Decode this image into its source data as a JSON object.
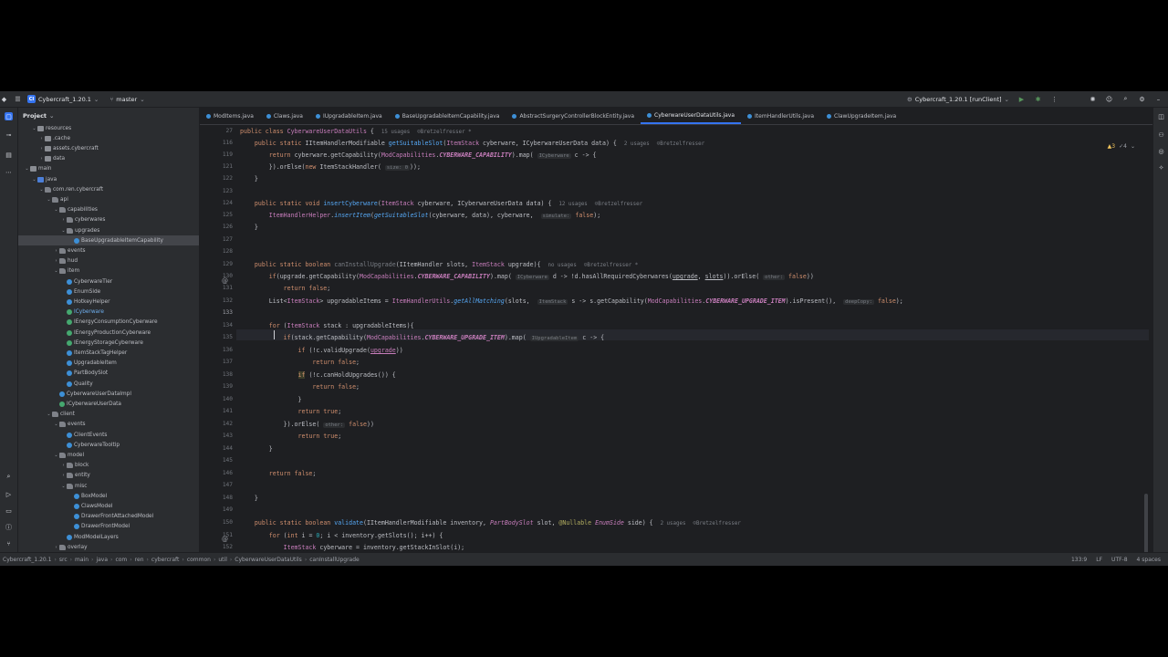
{
  "titlebar": {
    "project_badge": "CI",
    "project_name": "Cybercraft_1.20.1",
    "branch": "master",
    "run_config": "Cybercraft_1.20.1 [runClient]"
  },
  "project_panel": {
    "title": "Project",
    "rows": [
      {
        "label": "resources",
        "indent": 3,
        "icon": "folder",
        "twist": "v"
      },
      {
        "label": ".cache",
        "indent": 4,
        "icon": "folder",
        "twist": ">"
      },
      {
        "label": "assets.cybercraft",
        "indent": 4,
        "icon": "folder",
        "twist": ">"
      },
      {
        "label": "data",
        "indent": 4,
        "icon": "folder",
        "twist": ">"
      },
      {
        "label": "main",
        "indent": 2,
        "icon": "folder",
        "twist": "v"
      },
      {
        "label": "java",
        "indent": 3,
        "icon": "src",
        "twist": "v"
      },
      {
        "label": "com.ren.cybercraft",
        "indent": 4,
        "icon": "pkg",
        "twist": "v"
      },
      {
        "label": "api",
        "indent": 5,
        "icon": "pkg",
        "twist": "v"
      },
      {
        "label": "capabilities",
        "indent": 6,
        "icon": "pkg",
        "twist": "v"
      },
      {
        "label": "cyberwares",
        "indent": 7,
        "icon": "pkg",
        "twist": ">"
      },
      {
        "label": "upgrades",
        "indent": 7,
        "icon": "pkg",
        "twist": "v"
      },
      {
        "label": "BaseUpgradableItemCapability",
        "indent": 8,
        "icon": "cls",
        "twist": "",
        "selected": true
      },
      {
        "label": "events",
        "indent": 6,
        "icon": "pkg",
        "twist": ">"
      },
      {
        "label": "hud",
        "indent": 6,
        "icon": "pkg",
        "twist": ">"
      },
      {
        "label": "item",
        "indent": 6,
        "icon": "pkg",
        "twist": "v"
      },
      {
        "label": "CyberwareTier",
        "indent": 7,
        "icon": "cls",
        "twist": ""
      },
      {
        "label": "EnumSide",
        "indent": 7,
        "icon": "cls",
        "twist": ""
      },
      {
        "label": "HotkeyHelper",
        "indent": 7,
        "icon": "cls",
        "twist": ""
      },
      {
        "label": "ICyberware",
        "indent": 7,
        "icon": "itf",
        "twist": "",
        "blue": true
      },
      {
        "label": "IEnergyConsumptionCyberware",
        "indent": 7,
        "icon": "itf",
        "twist": ""
      },
      {
        "label": "IEnergyProductionCyberware",
        "indent": 7,
        "icon": "itf",
        "twist": ""
      },
      {
        "label": "IEnergyStorageCyberware",
        "indent": 7,
        "icon": "itf",
        "twist": ""
      },
      {
        "label": "ItemStackTagHelper",
        "indent": 7,
        "icon": "cls",
        "twist": ""
      },
      {
        "label": "UpgradableItem",
        "indent": 7,
        "icon": "cls",
        "twist": ""
      },
      {
        "label": "PartBodySlot",
        "indent": 7,
        "icon": "cls",
        "twist": ""
      },
      {
        "label": "Quality",
        "indent": 7,
        "icon": "cls",
        "twist": ""
      },
      {
        "label": "CyberwareUserDataImpl",
        "indent": 6,
        "icon": "cls",
        "twist": ""
      },
      {
        "label": "ICyberwareUserData",
        "indent": 6,
        "icon": "itf",
        "twist": ""
      },
      {
        "label": "client",
        "indent": 5,
        "icon": "pkg",
        "twist": "v"
      },
      {
        "label": "events",
        "indent": 6,
        "icon": "pkg",
        "twist": "v"
      },
      {
        "label": "ClientEvents",
        "indent": 7,
        "icon": "cls",
        "twist": ""
      },
      {
        "label": "CyberwareTooltip",
        "indent": 7,
        "icon": "cls",
        "twist": ""
      },
      {
        "label": "model",
        "indent": 6,
        "icon": "pkg",
        "twist": "v"
      },
      {
        "label": "block",
        "indent": 7,
        "icon": "pkg",
        "twist": ">"
      },
      {
        "label": "entity",
        "indent": 7,
        "icon": "pkg",
        "twist": ">"
      },
      {
        "label": "misc",
        "indent": 7,
        "icon": "pkg",
        "twist": "v"
      },
      {
        "label": "BoxModel",
        "indent": 8,
        "icon": "cls",
        "twist": ""
      },
      {
        "label": "ClawsModel",
        "indent": 8,
        "icon": "cls",
        "twist": ""
      },
      {
        "label": "DrawerFrontAttachedModel",
        "indent": 8,
        "icon": "cls",
        "twist": ""
      },
      {
        "label": "DrawerFrontModel",
        "indent": 8,
        "icon": "cls",
        "twist": ""
      },
      {
        "label": "ModModelLayers",
        "indent": 7,
        "icon": "cls",
        "twist": ""
      },
      {
        "label": "overlay",
        "indent": 6,
        "icon": "pkg",
        "twist": ">"
      }
    ]
  },
  "tabs": [
    {
      "label": "ModItems.java",
      "active": false
    },
    {
      "label": "Claws.java",
      "active": false
    },
    {
      "label": "IUpgradableItem.java",
      "active": false
    },
    {
      "label": "BaseUpgradableItemCapability.java",
      "active": false
    },
    {
      "label": "AbstractSurgeryControllerBlockEntity.java",
      "active": false
    },
    {
      "label": "CyberwareUserDataUtils.java",
      "active": true
    },
    {
      "label": "ItemHandlerUtils.java",
      "active": false
    },
    {
      "label": "ClawUpgradeItem.java",
      "active": false
    }
  ],
  "inspections": {
    "warnings": "▲3",
    "weak": "✓4"
  },
  "line_numbers": [
    "27",
    "116",
    "119",
    "121",
    "122",
    "123",
    "124",
    "125",
    "126",
    "127",
    "128",
    "129",
    "130",
    "131",
    "132",
    "133",
    "134",
    "135",
    "136",
    "137",
    "138",
    "139",
    "140",
    "141",
    "142",
    "143",
    "144",
    "145",
    "146",
    "147",
    "148",
    "149",
    "150",
    "151",
    "152"
  ],
  "current_line": "133",
  "code": {
    "header": {
      "usages": "15 usages",
      "author": "Bretzelfresser *"
    },
    "l116": {
      "usages": "2 usages",
      "author": "Bretzelfresser"
    },
    "l121_hint": "size: 0",
    "l124": {
      "usages": "12 usages",
      "author": "Bretzelfresser"
    },
    "l125_hint": "simulate:",
    "l129": {
      "usages": "no usages",
      "author": "Bretzelfresser *"
    },
    "hint_icyberware": "ICyberware",
    "hint_other": "other:",
    "hint_itemstack": "ItemStack",
    "hint_deepcopy": "deepCopy:",
    "hint_iupgradable": "IUpgradableItem",
    "l150": {
      "usages": "2 usages",
      "author": "Bretzelfresser"
    }
  },
  "status": {
    "crumbs": [
      "Cybercraft_1.20.1",
      "src",
      "main",
      "java",
      "com",
      "ren",
      "cybercraft",
      "common",
      "util",
      "CyberwareUserDataUtils",
      "canInstallUpgrade"
    ],
    "position": "133:9",
    "line_sep": "LF",
    "encoding": "UTF-8",
    "indent": "4 spaces"
  }
}
